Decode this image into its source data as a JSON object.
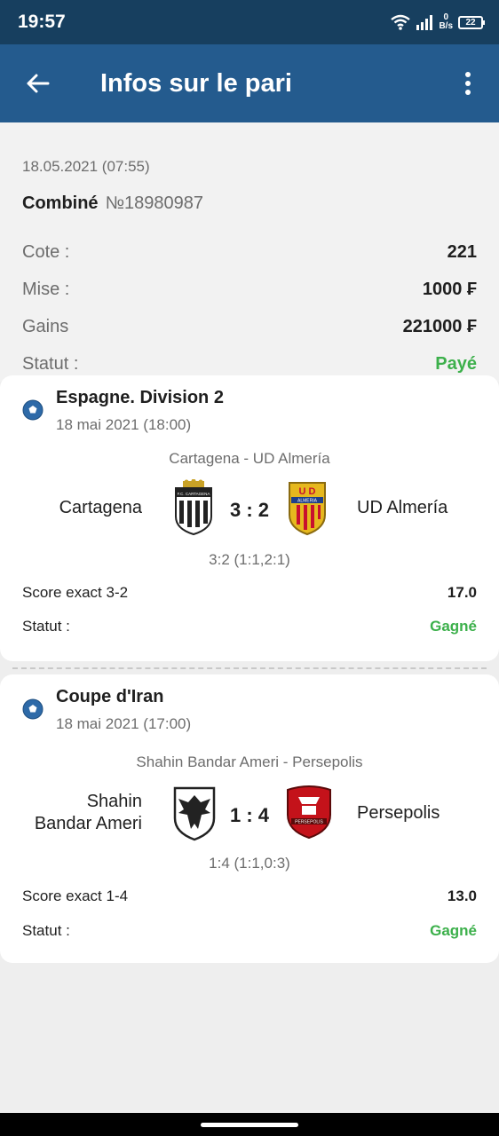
{
  "status_bar": {
    "time": "19:57",
    "net_speed_value": "0",
    "net_speed_unit": "B/s",
    "battery": "22"
  },
  "app_bar": {
    "title": "Infos sur le pari"
  },
  "summary": {
    "date": "18.05.2021 (07:55)",
    "bet_type": "Combiné",
    "bet_number": "№18980987",
    "rows": [
      {
        "label": "Cote :",
        "value": "221"
      },
      {
        "label": "Mise :",
        "value": "1000 ₣"
      },
      {
        "label": "Gains",
        "value": "221000 ₣"
      },
      {
        "label": "Statut :",
        "value": "Payé"
      }
    ]
  },
  "events": [
    {
      "league": "Espagne. Division 2",
      "date": "18 mai 2021 (18:00)",
      "matchup": "Cartagena - UD Almería",
      "home_team": "Cartagena",
      "away_team": "UD Almería",
      "score": "3 : 2",
      "detail": "3:2 (1:1,2:1)",
      "market": "Score exact 3-2",
      "odds": "17.0",
      "status_label": "Statut :",
      "status": "Gagné",
      "home_logo_text": "F.C. CARTAGENA",
      "away_logo_text_top": "U D",
      "away_logo_text": "ALMERIA"
    },
    {
      "league": "Coupe d'Iran",
      "date": "18 mai 2021 (17:00)",
      "matchup": "Shahin Bandar Ameri - Persepolis",
      "home_team_line1": "Shahin",
      "home_team_line2": "Bandar Ameri",
      "away_team": "Persepolis",
      "score": "1 : 4",
      "detail": "1:4 (1:1,0:3)",
      "market": "Score exact 1-4",
      "odds": "13.0",
      "status_label": "Statut :",
      "status": "Gagné",
      "away_logo_text": "PERSEPOLIS"
    }
  ],
  "colors": {
    "status_bar": "#173f5f",
    "app_bar": "#245b8e",
    "win_green": "#3cb04b"
  },
  "icons": [
    "wifi-icon",
    "signal-icon",
    "battery-icon",
    "back-arrow-icon",
    "more-vert-icon",
    "soccer-ball-icon"
  ]
}
